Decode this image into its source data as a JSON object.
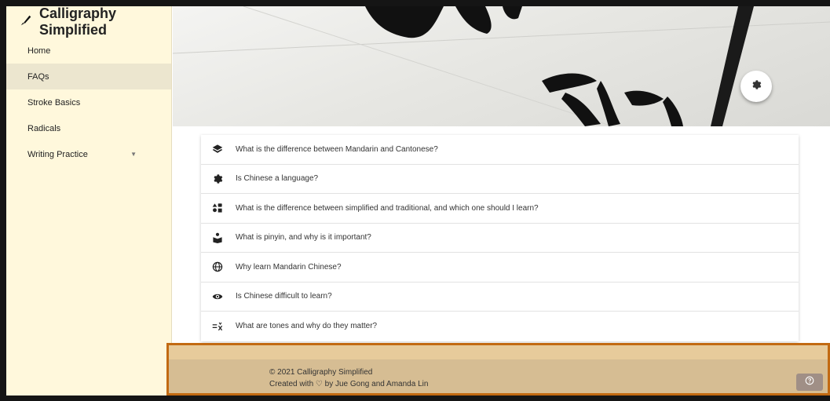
{
  "brand": {
    "title": "Calligraphy Simplified",
    "icon": "brush-icon"
  },
  "sidebar": {
    "items": [
      {
        "label": "Home"
      },
      {
        "label": "FAQs",
        "active": true
      },
      {
        "label": "Stroke Basics"
      },
      {
        "label": "Radicals"
      },
      {
        "label": "Writing Practice",
        "has_dropdown": true
      }
    ]
  },
  "hero": {
    "settings_icon": "gear-icon"
  },
  "faq": {
    "items": [
      {
        "icon": "layers-icon",
        "text": "What is the difference between Mandarin and Cantonese?"
      },
      {
        "icon": "gear-icon",
        "text": "Is Chinese a language?"
      },
      {
        "icon": "shapes-icon",
        "text": "What is the difference between simplified and traditional, and which one should I learn?"
      },
      {
        "icon": "reader-icon",
        "text": "What is pinyin, and why is it important?"
      },
      {
        "icon": "globe-icon",
        "text": "Why learn Mandarin Chinese?"
      },
      {
        "icon": "eye-icon",
        "text": "Is Chinese difficult to learn?"
      },
      {
        "icon": "compare-icon",
        "text": "What are tones and why do they matter?"
      }
    ]
  },
  "footer": {
    "copyright": "© 2021 Calligraphy Simplified",
    "credit": "Created with ♡ by Jue Gong and Amanda Lin",
    "help_icon": "help-icon"
  },
  "colors": {
    "sidebar_bg": "#fff8dc",
    "footer_bg": "#d6bd93",
    "footer_border": "#c26a12",
    "help_button": "#a08f86"
  }
}
